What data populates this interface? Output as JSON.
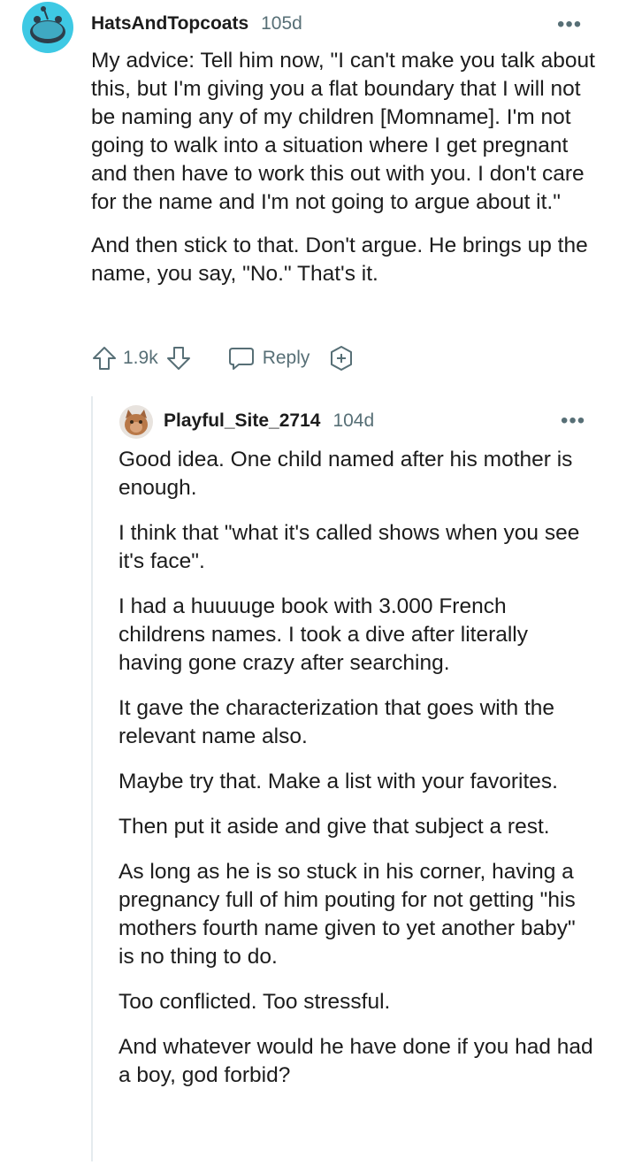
{
  "comments": [
    {
      "username": "HatsAndTopcoats",
      "age": "105d",
      "paragraphs": [
        "My advice: Tell him now, \"I can't make you talk about this, but I'm giving you a flat boundary that I will not be naming any of my children [Momname]. I'm not going to walk into a situation where I get pregnant and then have to work this out with you. I don't care for the name and I'm not going to argue about it.\"",
        "And then stick to that. Don't argue. He brings up the name, you say, \"No.\" That's it."
      ],
      "votes": "1.9k",
      "reply_label": "Reply"
    },
    {
      "username": "Playful_Site_2714",
      "age": "104d",
      "paragraphs": [
        "Good idea. One child named after his mother is enough.",
        "I think that \"what it's called shows when you see it's face\".",
        "I had a huuuuge book with 3.000 French childrens names. I took a dive after literally having gone crazy after searching.",
        "It gave the characterization that goes with the relevant name also.",
        "Maybe try that. Make a list with your favorites.",
        "Then put it aside and give that subject a rest.",
        "As long as he is so stuck in his corner, having a pregnancy full of him pouting for not getting \"his mothers fourth name given to yet another baby\" is no thing to do.",
        "Too conflicted. Too stressful.",
        "And whatever would he have done if you had had a boy, god forbid?"
      ]
    }
  ],
  "more_label": "•••"
}
